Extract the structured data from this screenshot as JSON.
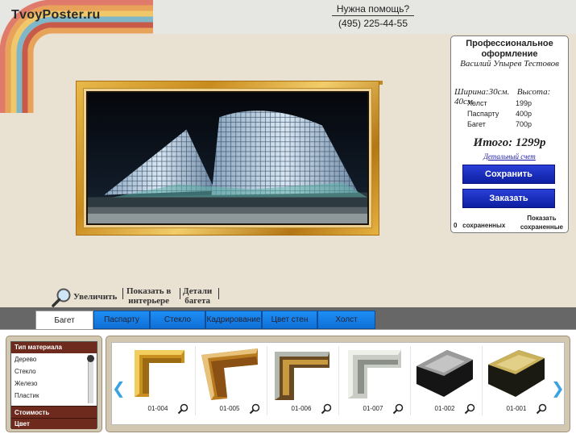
{
  "header": {
    "logo_text": "TvoyPoster.ru",
    "help_title": "Нужна помощь?",
    "help_phone": "(495) 225-44-55"
  },
  "panel": {
    "title": "Профессиональное оформление",
    "author": "Василий Упырев Тестовов",
    "width_label": "Ширина:",
    "width_value": "30см.",
    "height_label": "Высота:",
    "height_value": "40см.",
    "prices": [
      {
        "name": "Холст",
        "value": "199р"
      },
      {
        "name": "Паспарту",
        "value": "400р"
      },
      {
        "name": "Багет",
        "value": "700р"
      }
    ],
    "total_label": "Итого:",
    "total_value": "1299р",
    "detail_link": "Детальный счет",
    "save_button": "Сохранить",
    "order_button": "Заказать",
    "saved_count": "0",
    "saved_label": "сохраненных",
    "show_saved_line1": "Показать",
    "show_saved_line2": "сохраненные"
  },
  "toolbar": {
    "zoom": "Увеличить",
    "interior_1": "Показать в",
    "interior_2": "интерьере",
    "details_1": "Детали",
    "details_2": "багета"
  },
  "tabs": [
    {
      "label": "Багет",
      "active": true
    },
    {
      "label": "Паспарту",
      "active": false
    },
    {
      "label": "Стекло",
      "active": false
    },
    {
      "label": "Кадрирование",
      "active": false
    },
    {
      "label": "Цвет стен",
      "active": false
    },
    {
      "label": "Холст",
      "active": false
    }
  ],
  "filters": {
    "material_header": "Тип материала",
    "materials": [
      "Дерево",
      "Стекло",
      "Железо",
      "Пластик"
    ],
    "cost_header": "Стоимость",
    "color_header": "Цвет"
  },
  "frames": [
    {
      "code": "01-004"
    },
    {
      "code": "01-005"
    },
    {
      "code": "01-006"
    },
    {
      "code": "01-007"
    },
    {
      "code": "01-002"
    },
    {
      "code": "01-001"
    }
  ],
  "arrows": {
    "left": "❮",
    "right": "❯"
  }
}
